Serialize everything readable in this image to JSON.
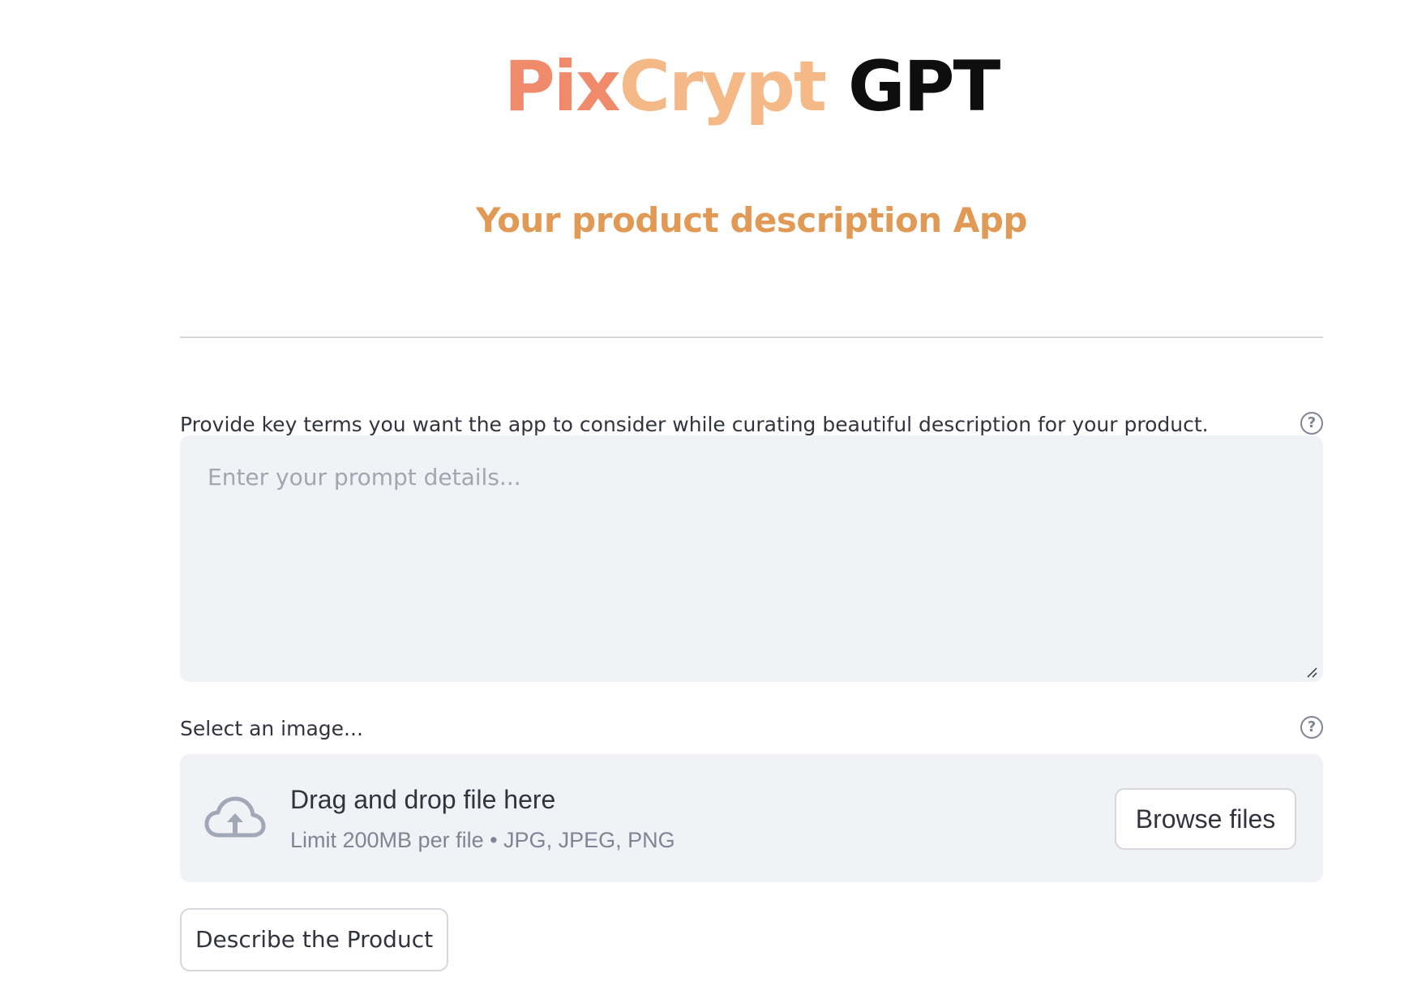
{
  "header": {
    "title_part1": "Pix",
    "title_part2": "Crypt",
    "title_part3": "GPT",
    "subtitle": "Your product description App"
  },
  "prompt": {
    "label": "Provide key terms you want the app to consider while curating beautiful description for your product.",
    "placeholder": "Enter your prompt details...",
    "value": "",
    "help_icon": "question-circle-icon"
  },
  "uploader": {
    "label": "Select an image...",
    "help_icon": "question-circle-icon",
    "icon": "cloud-upload-icon",
    "drop_text": "Drag and drop file here",
    "limit_text": "Limit 200MB per file • JPG, JPEG, PNG",
    "browse_label": "Browse files"
  },
  "actions": {
    "describe_label": "Describe the Product"
  },
  "colors": {
    "title_pix": "#ef8a6a",
    "title_crypt": "#f4b987",
    "title_gpt": "#0e0e0e",
    "subtitle": "#e09a55",
    "input_bg": "#f0f2f6"
  }
}
